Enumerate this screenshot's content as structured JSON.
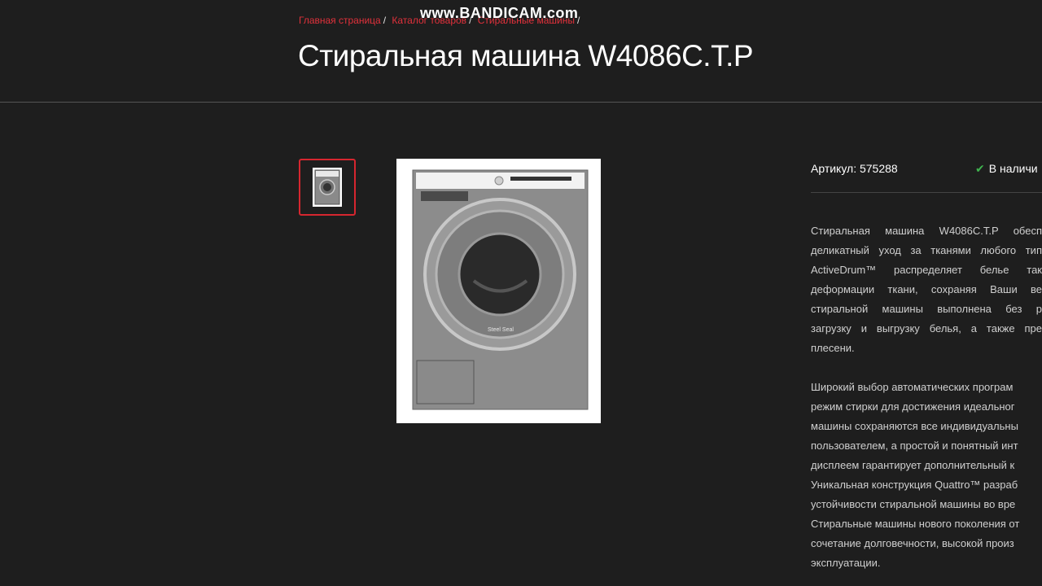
{
  "breadcrumb": {
    "items": [
      "Главная страница",
      "Каталог товаров",
      "Стиральные машины"
    ],
    "separator": "/"
  },
  "watermark": "www.BANDICAM.com",
  "product": {
    "title": "Стиральная машина W4086C.T.P",
    "sku_label": "Артикул:",
    "sku_value": "575288",
    "stock_text": "В наличи",
    "image_label": "Steel Seal"
  },
  "description": {
    "paragraph1": [
      "Стиральная машина W4086C.T.P обесп",
      "деликатный уход за тканями любого тип",
      "ActiveDrum™ распределяет белье так",
      "деформации ткани, сохраняя Ваши ве",
      "стиральной машины выполнена без р",
      "загрузку и выгрузку белья, а также пре",
      "плесени."
    ],
    "paragraph2": [
      "Широкий выбор автоматических програм",
      "режим стирки для достижения идеальног",
      "машины сохраняются все индивидуальны",
      "пользователем, а простой и понятный инт",
      "дисплеем гарантирует дополнительный к",
      "Уникальная конструкция Quattro™ разраб",
      "устойчивости стиральной машины во вре",
      "Стиральные машины нового поколения от",
      "сочетание долговечности, высокой произ",
      "эксплуатации."
    ]
  },
  "colors": {
    "background": "#1e1e1e",
    "accent": "#e0313b",
    "in_stock": "#3fb34f"
  }
}
